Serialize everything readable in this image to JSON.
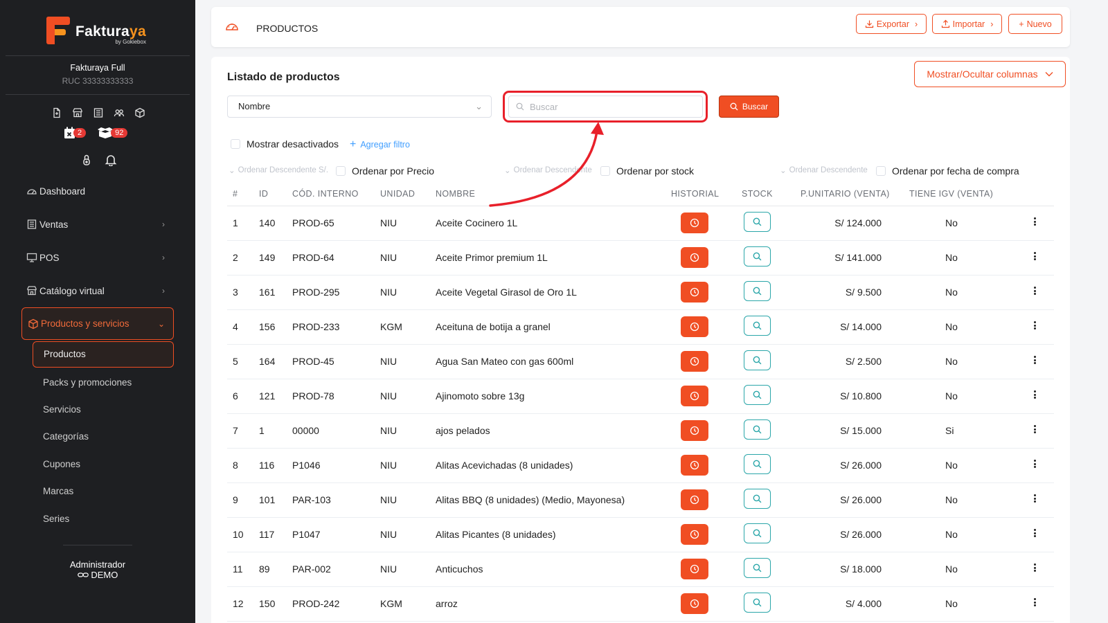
{
  "brand": {
    "name_main": "Fakturaya",
    "byline": "by Gokiebox"
  },
  "company": {
    "name": "Fakturaya Full",
    "ruc": "RUC 33333333333"
  },
  "badges": {
    "calendar_count": "2",
    "orders_count": "92"
  },
  "nav": {
    "dashboard": "Dashboard",
    "ventas": "Ventas",
    "pos": "POS",
    "catalogo": "Catálogo virtual",
    "productos_servicios": "Productos y servicios",
    "sub": [
      "Productos",
      "Packs y promociones",
      "Servicios",
      "Categorías",
      "Cupones",
      "Marcas",
      "Series"
    ]
  },
  "footer": {
    "role": "Administrador",
    "user": "DEMO"
  },
  "header": {
    "title": "PRODUCTOS",
    "export_label": "Exportar",
    "import_label": "Importar",
    "new_label": "Nuevo"
  },
  "list": {
    "title": "Listado de productos",
    "columns_toggle": "Mostrar/Ocultar columnas",
    "field_select": "Nombre",
    "search_placeholder": "Buscar",
    "search_button": "Buscar",
    "show_disabled": "Mostrar desactivados",
    "add_filter": "Agregar filtro",
    "sort_price_order": "Ordenar Descendente S/.",
    "sort_price_label": "Ordenar por Precio",
    "sort_stock_order": "Ordenar Descendente",
    "sort_stock_label": "Ordenar por stock",
    "sort_date_order": "Ordenar Descendente",
    "sort_date_label": "Ordenar por fecha de compra"
  },
  "table": {
    "headers": [
      "#",
      "ID",
      "CÓD. INTERNO",
      "UNIDAD",
      "NOMBRE",
      "HISTORIAL",
      "STOCK",
      "P.UNITARIO (VENTA)",
      "TIENE IGV (VENTA)"
    ],
    "rows": [
      {
        "n": "1",
        "id": "140",
        "code": "PROD-65",
        "unit": "NIU",
        "name": "Aceite Cocinero 1L",
        "price": "S/ 124.000",
        "igv": "No"
      },
      {
        "n": "2",
        "id": "149",
        "code": "PROD-64",
        "unit": "NIU",
        "name": "Aceite Primor premium 1L",
        "price": "S/ 141.000",
        "igv": "No"
      },
      {
        "n": "3",
        "id": "161",
        "code": "PROD-295",
        "unit": "NIU",
        "name": "Aceite Vegetal Girasol de Oro 1L",
        "price": "S/ 9.500",
        "igv": "No"
      },
      {
        "n": "4",
        "id": "156",
        "code": "PROD-233",
        "unit": "KGM",
        "name": "Aceituna de botija a granel",
        "price": "S/ 14.000",
        "igv": "No"
      },
      {
        "n": "5",
        "id": "164",
        "code": "PROD-45",
        "unit": "NIU",
        "name": "Agua San Mateo con gas 600ml",
        "price": "S/ 2.500",
        "igv": "No"
      },
      {
        "n": "6",
        "id": "121",
        "code": "PROD-78",
        "unit": "NIU",
        "name": "Ajinomoto sobre 13g",
        "price": "S/ 10.800",
        "igv": "No"
      },
      {
        "n": "7",
        "id": "1",
        "code": "00000",
        "unit": "NIU",
        "name": "ajos pelados",
        "price": "S/ 15.000",
        "igv": "Si"
      },
      {
        "n": "8",
        "id": "116",
        "code": "P1046",
        "unit": "NIU",
        "name": "Alitas Acevichadas (8 unidades)",
        "price": "S/ 26.000",
        "igv": "No"
      },
      {
        "n": "9",
        "id": "101",
        "code": "PAR-103",
        "unit": "NIU",
        "name": "Alitas BBQ (8 unidades) (Medio, Mayonesa)",
        "price": "S/ 26.000",
        "igv": "No"
      },
      {
        "n": "10",
        "id": "117",
        "code": "P1047",
        "unit": "NIU",
        "name": "Alitas Picantes (8 unidades)",
        "price": "S/ 26.000",
        "igv": "No"
      },
      {
        "n": "11",
        "id": "89",
        "code": "PAR-002",
        "unit": "NIU",
        "name": "Anticuchos",
        "price": "S/ 18.000",
        "igv": "No"
      },
      {
        "n": "12",
        "id": "150",
        "code": "PROD-242",
        "unit": "KGM",
        "name": "arroz",
        "price": "S/ 4.000",
        "igv": "No"
      }
    ]
  },
  "colors": {
    "accent": "#f04e23",
    "sidebar_bg": "#1e1f22",
    "stock_teal": "#2aa6a9",
    "annotation_red": "#e8202a"
  }
}
